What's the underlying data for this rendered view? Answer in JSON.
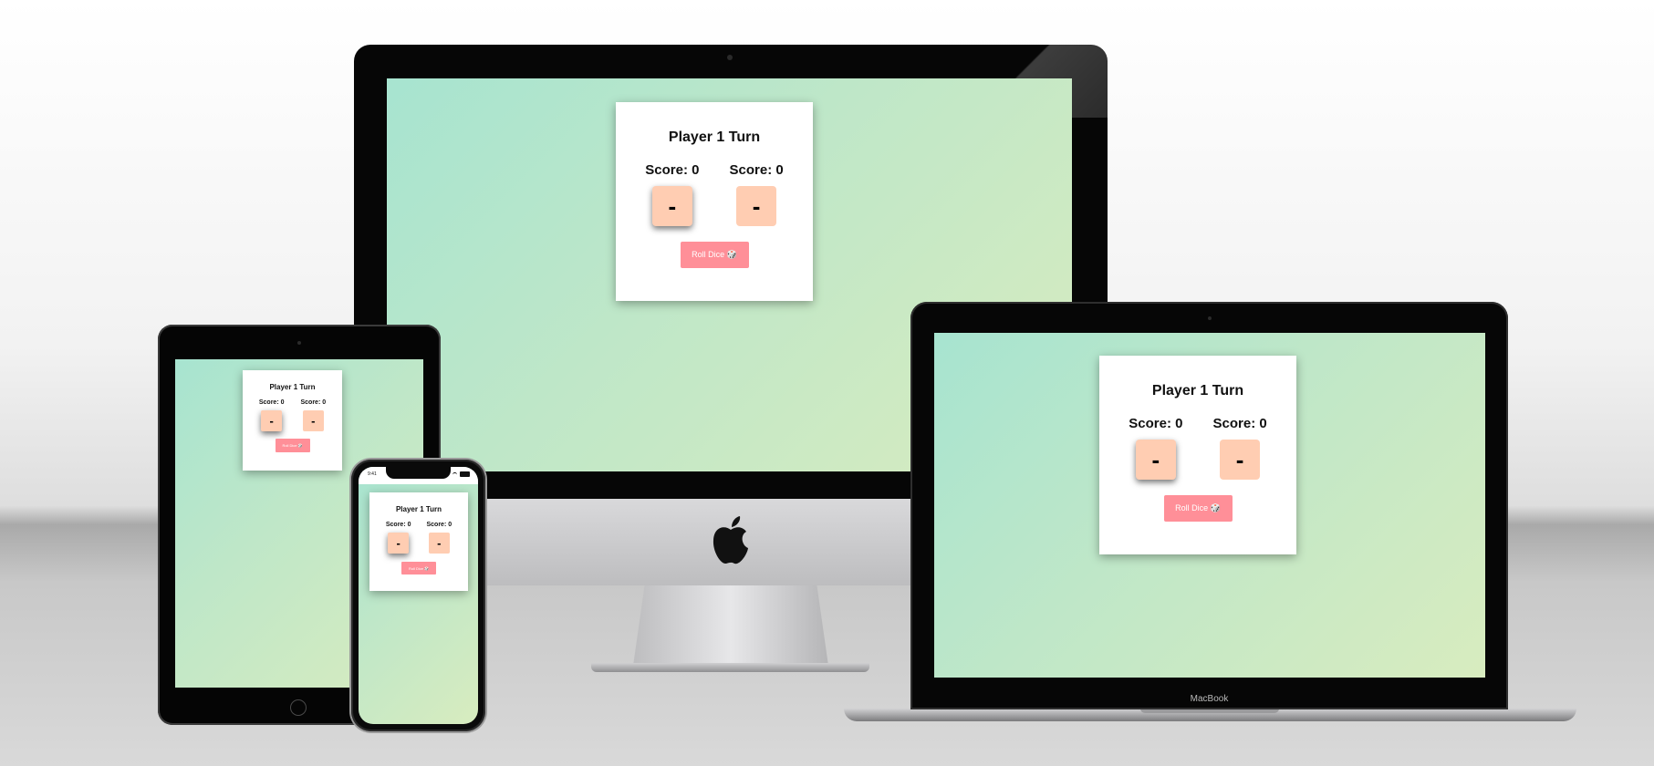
{
  "game": {
    "turn_label": "Player 1 Turn",
    "player1": {
      "score_label": "Score: 0",
      "die_value": "-"
    },
    "player2": {
      "score_label": "Score: 0",
      "die_value": "-"
    },
    "roll_button_label": "Roll Dice 🎲"
  },
  "laptop": {
    "brand_label": "MacBook"
  },
  "phone": {
    "status_time": "9:41"
  },
  "colors": {
    "background_gradient_start": "#a7e4d0",
    "background_gradient_end": "#d8ecbf",
    "die_color": "#ffcdb2",
    "button_color": "#ff8f98",
    "card_color": "#ffffff"
  },
  "icons": [
    "apple-logo-icon",
    "dice-icon",
    "camera-icon",
    "home-button-icon",
    "wifi-icon",
    "battery-icon"
  ]
}
